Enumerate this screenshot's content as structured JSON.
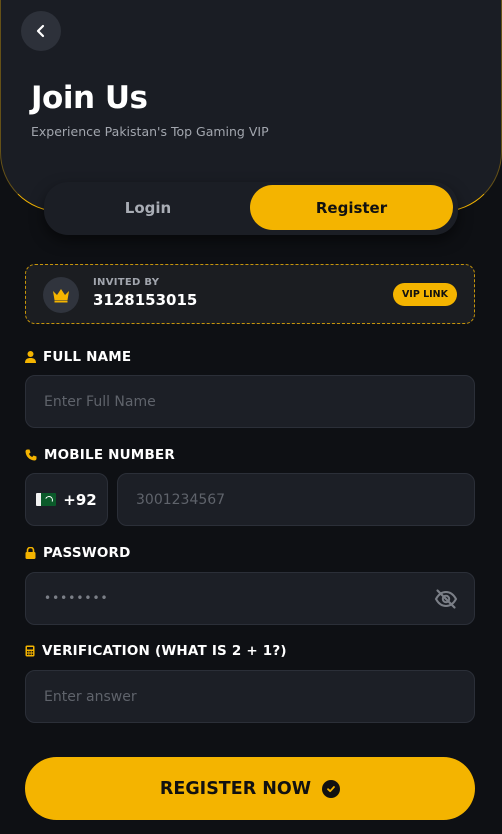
{
  "header": {
    "title": "Join Us",
    "subtitle": "Experience Pakistan's Top Gaming VIP"
  },
  "tabs": [
    {
      "label": "Login",
      "active": false
    },
    {
      "label": "Register",
      "active": true
    }
  ],
  "invite": {
    "label": "INVITED BY",
    "code": "3128153015",
    "badge": "VIP LINK"
  },
  "form": {
    "full_name": {
      "label": "FULL NAME",
      "placeholder": "Enter Full Name"
    },
    "mobile": {
      "label": "MOBILE NUMBER",
      "country_code": "+92",
      "placeholder": "3001234567"
    },
    "password": {
      "label": "PASSWORD",
      "value": "••••••••"
    },
    "verification": {
      "label": "VERIFICATION (WHAT IS 2 + 1?)",
      "placeholder": "Enter answer"
    }
  },
  "submit": {
    "label": "REGISTER NOW"
  },
  "colors": {
    "accent": "#f4b400",
    "background": "#0e1014",
    "card": "#1a1d24"
  },
  "icons": [
    "back-arrow-icon",
    "crown-icon",
    "user-icon",
    "phone-icon",
    "lock-icon",
    "calculator-icon",
    "eye-off-icon",
    "check-circle-icon",
    "pakistan-flag-icon"
  ]
}
